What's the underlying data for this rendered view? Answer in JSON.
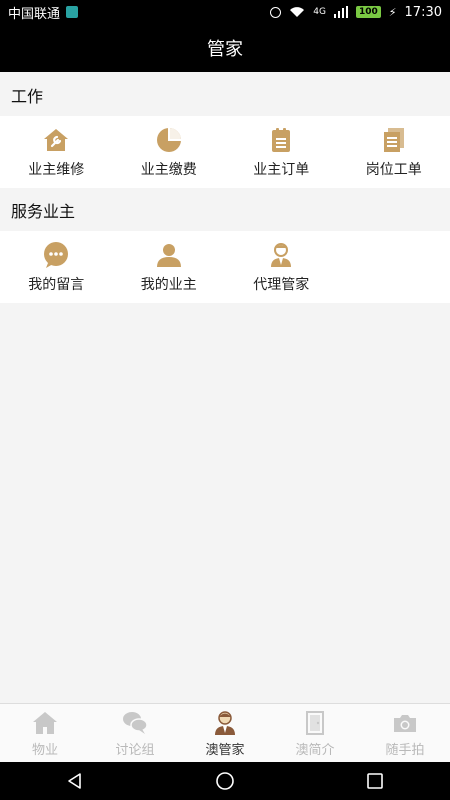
{
  "status": {
    "carrier": "中国联通",
    "network": "4G",
    "battery": "100",
    "time": "17:30"
  },
  "title": "管家",
  "sections": [
    {
      "title": "工作",
      "items": [
        {
          "label": "业主维修",
          "icon": "house-wrench-icon"
        },
        {
          "label": "业主缴费",
          "icon": "pie-chart-icon"
        },
        {
          "label": "业主订单",
          "icon": "clipboard-icon"
        },
        {
          "label": "岗位工单",
          "icon": "document-icon"
        }
      ]
    },
    {
      "title": "服务业主",
      "items": [
        {
          "label": "我的留言",
          "icon": "chat-bubble-icon"
        },
        {
          "label": "我的业主",
          "icon": "person-icon"
        },
        {
          "label": "代理管家",
          "icon": "butler-icon"
        }
      ]
    }
  ],
  "tabs": [
    {
      "label": "物业",
      "icon": "home-icon",
      "active": false
    },
    {
      "label": "讨论组",
      "icon": "chat-icon",
      "active": false
    },
    {
      "label": "澳管家",
      "icon": "butler-icon",
      "active": true
    },
    {
      "label": "澳简介",
      "icon": "door-icon",
      "active": false
    },
    {
      "label": "随手拍",
      "icon": "camera-icon",
      "active": false
    }
  ],
  "colors": {
    "accent": "#c8a063",
    "inactive": "#c8c8c8",
    "active_tab_icon": "#8a5a3a"
  }
}
